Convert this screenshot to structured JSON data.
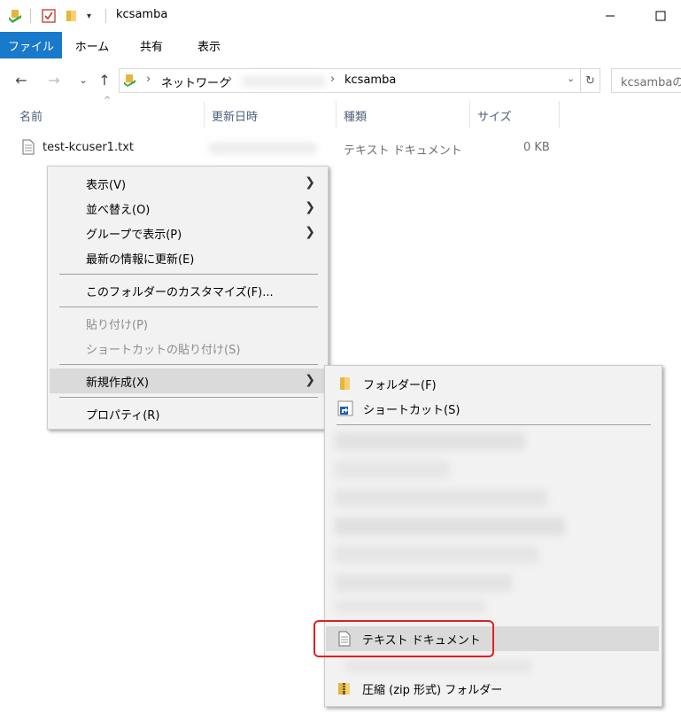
{
  "window": {
    "title": "kcsamba",
    "minimize_icon": "minimize-icon",
    "maximize_icon": "maximize-icon"
  },
  "ribbon": {
    "tabs": [
      "ファイル",
      "ホーム",
      "共有",
      "表示"
    ]
  },
  "address": {
    "crumbs": [
      "ネットワーク",
      "kcsamba"
    ],
    "search_placeholder": "kcsambaの検索"
  },
  "columns": {
    "name": "名前",
    "date": "更新日時",
    "type": "種類",
    "size": "サイズ"
  },
  "file": {
    "name": "test-kcuser1.txt",
    "type": "テキスト ドキュメント",
    "size": "0 KB"
  },
  "context_menu": {
    "items": [
      {
        "label": "表示(V)",
        "submenu": true
      },
      {
        "label": "並べ替え(O)",
        "submenu": true
      },
      {
        "label": "グループで表示(P)",
        "submenu": true
      },
      {
        "label": "最新の情報に更新(E)"
      },
      {
        "label": "このフォルダーのカスタマイズ(F)..."
      },
      {
        "label": "貼り付け(P)",
        "disabled": true
      },
      {
        "label": "ショートカットの貼り付け(S)",
        "disabled": true
      },
      {
        "label": "新規作成(X)",
        "submenu": true,
        "active": true
      },
      {
        "label": "プロパティ(R)"
      }
    ]
  },
  "submenu": {
    "items": [
      {
        "label": "フォルダー(F)",
        "icon": "folder-icon"
      },
      {
        "label": "ショートカット(S)",
        "icon": "shortcut-icon"
      },
      {
        "label": "テキスト ドキュメント",
        "icon": "text-document-icon",
        "highlighted": true
      },
      {
        "label": "圧縮 (zip 形式) フォルダー",
        "icon": "zip-folder-icon"
      }
    ]
  },
  "colors": {
    "accent": "#1979ca",
    "highlight_border": "#e02020",
    "menu_bg": "#f2f2f2"
  }
}
